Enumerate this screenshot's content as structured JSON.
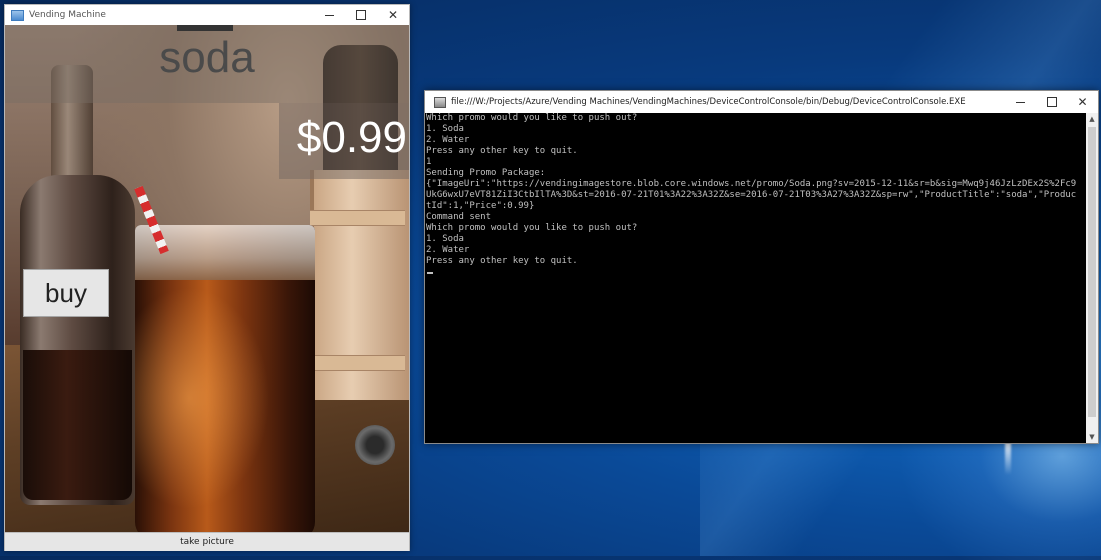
{
  "vending_window": {
    "title": "Vending Machine",
    "product_title": "soda",
    "price": "$0.99",
    "buy_label": "buy",
    "take_picture_label": "take picture"
  },
  "console_window": {
    "title": "file:///W:/Projects/Azure/Vending Machines/VendingMachines/DeviceControlConsole/bin/Debug/DeviceControlConsole.EXE",
    "lines": [
      "Which promo would you like to push out?",
      "1. Soda",
      "2. Water",
      "Press any other key to quit.",
      "1",
      "Sending Promo Package:",
      "{\"ImageUri\":\"https://vendingimagestore.blob.core.windows.net/promo/Soda.png?sv=2015-12-11&sr=b&sig=Mwq9j46JzLzDEx2S%2Fc9",
      "UkG6wxU7eVT81ZiI3CtbIlTA%3D&st=2016-07-21T01%3A22%3A32Z&se=2016-07-21T03%3A27%3A32Z&sp=rw\",\"ProductTitle\":\"soda\",\"Produc",
      "tId\":1,\"Price\":0.99}",
      "Command sent",
      "Which promo would you like to push out?",
      "1. Soda",
      "2. Water",
      "Press any other key to quit."
    ]
  },
  "icons": {
    "minimize": "minimize-icon",
    "maximize": "maximize-icon",
    "close": "close-icon",
    "app": "app-icon",
    "console": "console-icon"
  }
}
